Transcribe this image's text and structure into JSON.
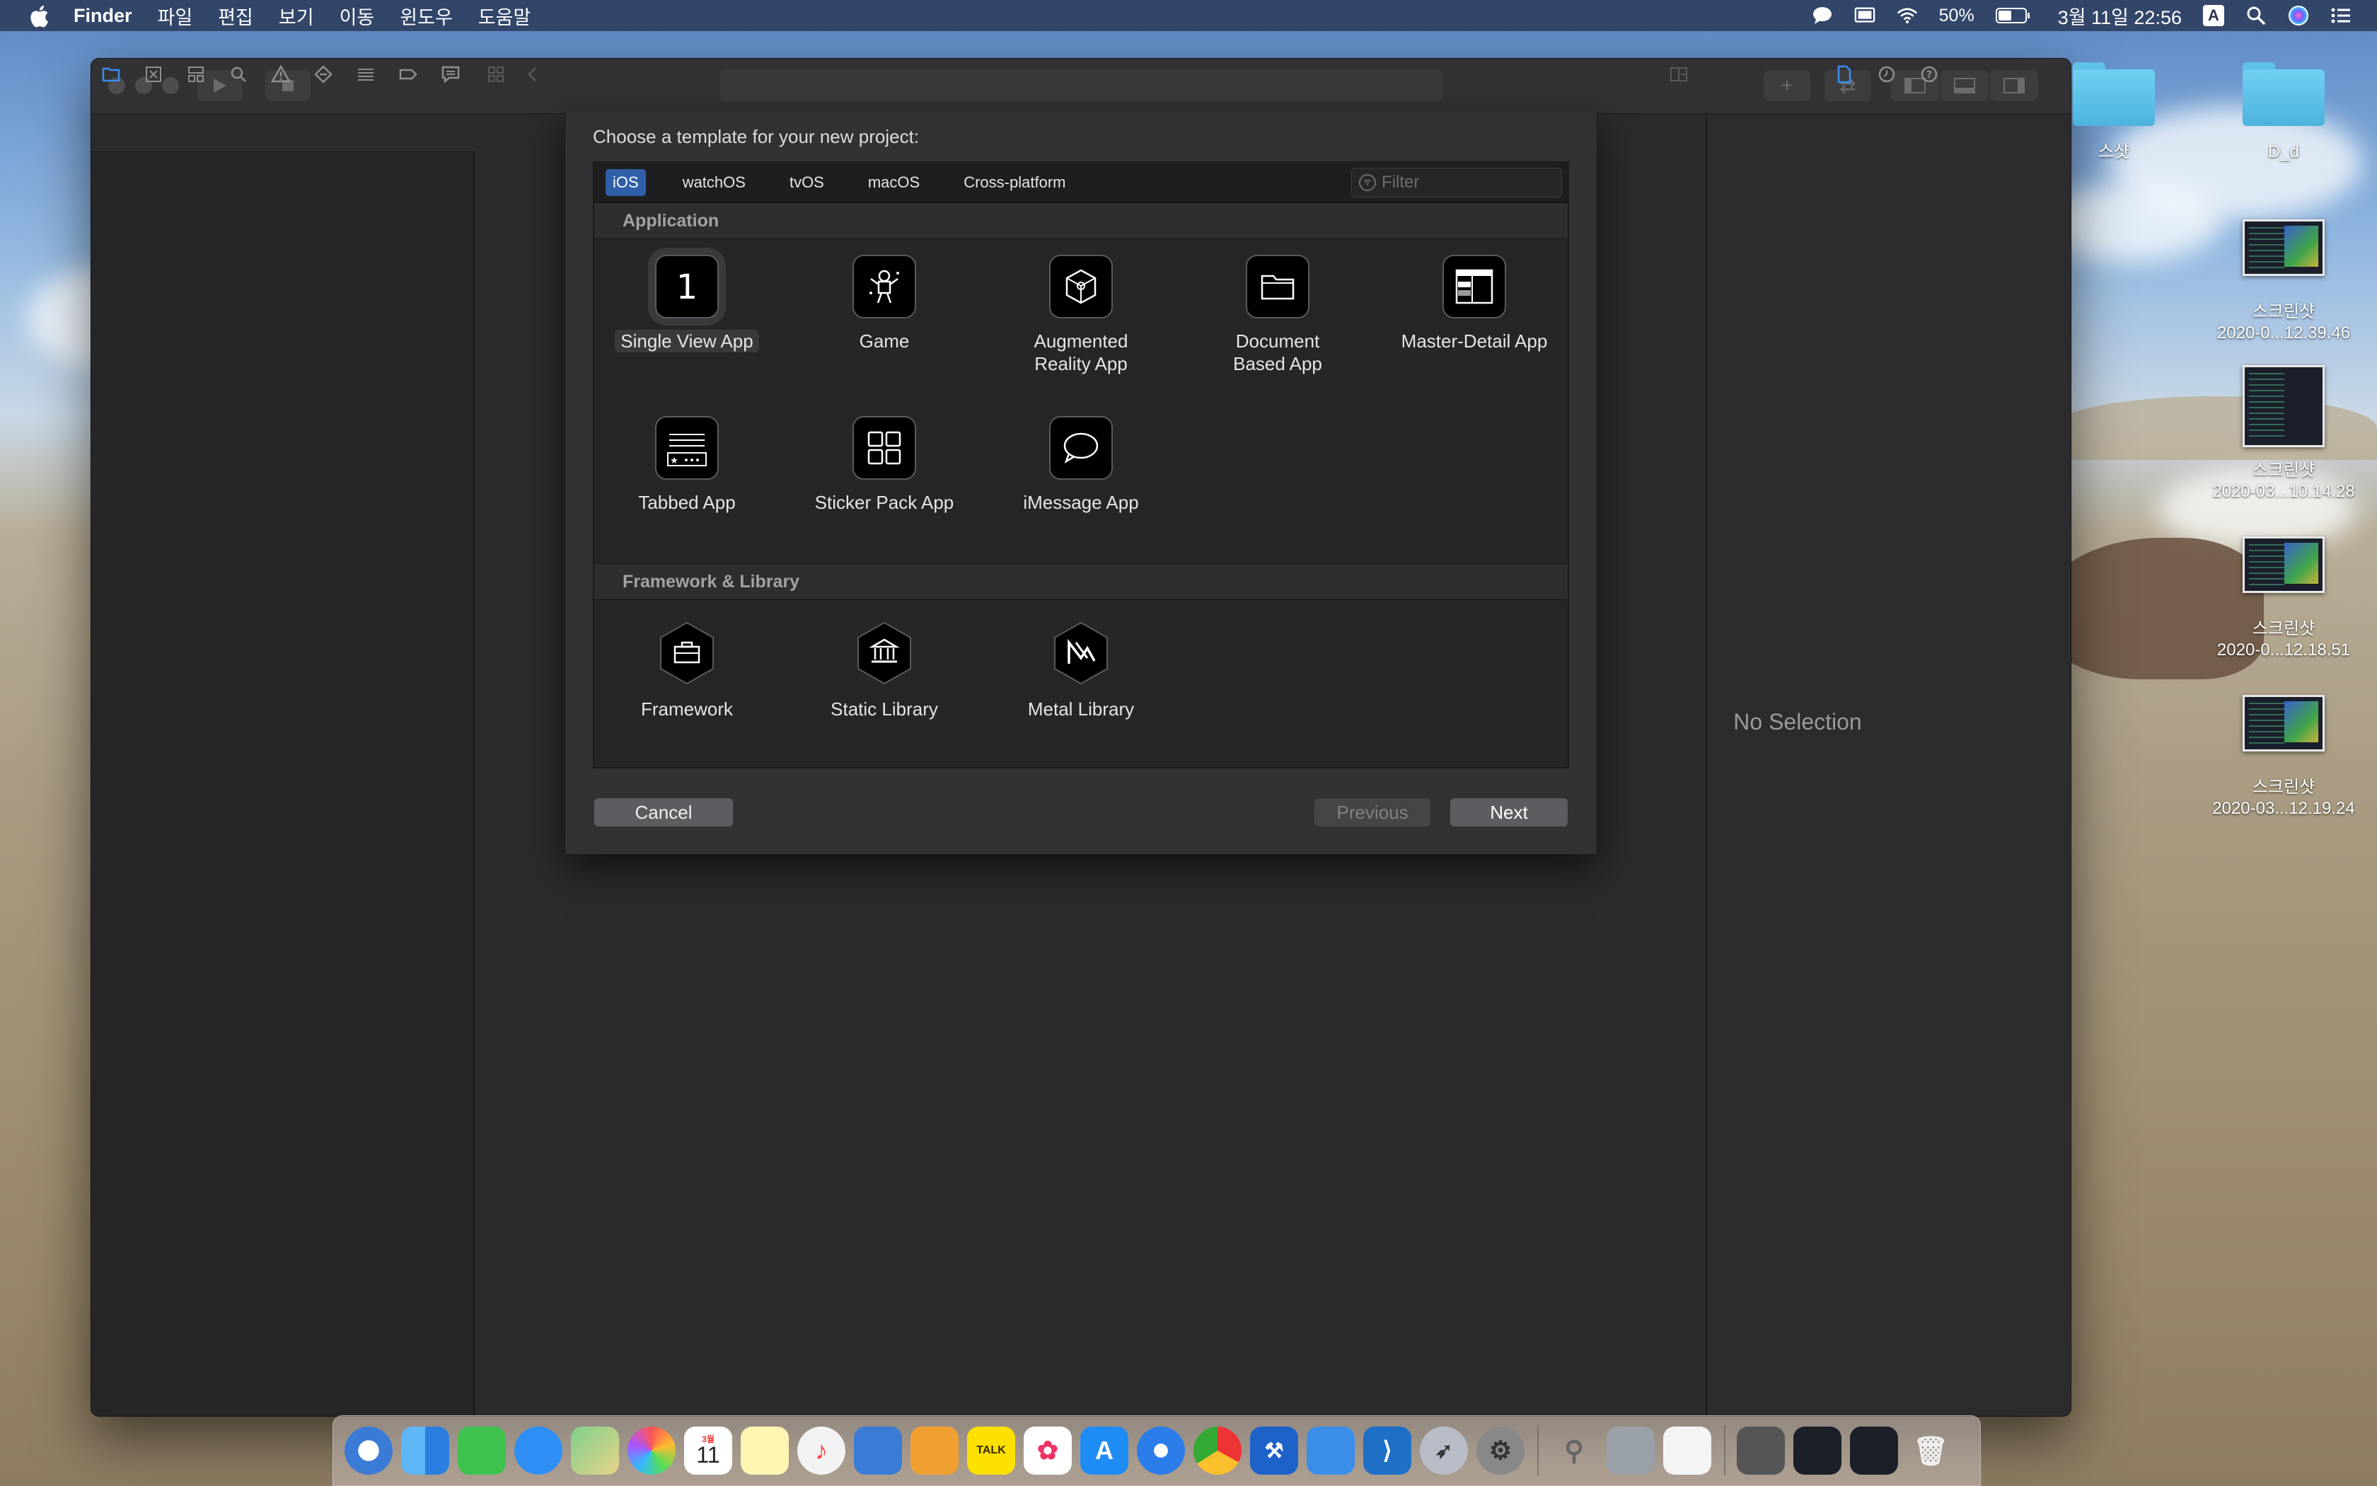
{
  "menubar": {
    "app_name": "Finder",
    "menus": [
      "파일",
      "편집",
      "보기",
      "이동",
      "윈도우",
      "도움말"
    ],
    "battery": "50%",
    "battery_level": 0.5,
    "datetime": "3월 11일  22:56",
    "input_method": "A"
  },
  "sheet": {
    "title": "Choose a template for your new project:",
    "tabs": [
      "iOS",
      "watchOS",
      "tvOS",
      "macOS",
      "Cross-platform"
    ],
    "active_tab": "iOS",
    "filter_placeholder": "Filter",
    "sections": {
      "application": {
        "header": "Application",
        "templates": [
          {
            "label_line1": "Single View App",
            "label_line2": "",
            "icon": "single-view-icon",
            "selected": true
          },
          {
            "label_line1": "Game",
            "label_line2": "",
            "icon": "game-icon"
          },
          {
            "label_line1": "Augmented",
            "label_line2": "Reality App",
            "icon": "ar-cube-icon"
          },
          {
            "label_line1": "Document",
            "label_line2": "Based App",
            "icon": "folder-icon"
          },
          {
            "label_line1": "Master-Detail App",
            "label_line2": "",
            "icon": "master-detail-icon"
          },
          {
            "label_line1": "Tabbed App",
            "label_line2": "",
            "icon": "tabbed-icon"
          },
          {
            "label_line1": "Sticker Pack App",
            "label_line2": "",
            "icon": "sticker-grid-icon"
          },
          {
            "label_line1": "iMessage App",
            "label_line2": "",
            "icon": "speech-bubble-icon"
          }
        ]
      },
      "framework": {
        "header": "Framework & Library",
        "templates": [
          {
            "label": "Framework",
            "icon": "toolbox-icon"
          },
          {
            "label": "Static Library",
            "icon": "library-building-icon"
          },
          {
            "label": "Metal Library",
            "icon": "metal-icon"
          }
        ]
      }
    },
    "buttons": {
      "cancel": "Cancel",
      "previous": "Previous",
      "next": "Next"
    }
  },
  "inspector": {
    "empty_text": "No Selection"
  },
  "desktop": {
    "items": [
      {
        "label": "스샷",
        "kind": "folder"
      },
      {
        "label": "D_d",
        "kind": "folder"
      },
      {
        "label_line1": "스크린샷",
        "label_line2": "2020-0...12.39.46",
        "kind": "screenshot"
      },
      {
        "label_line1": "스크린샷",
        "label_line2": "2020-03...10.14.28",
        "kind": "screenshot"
      },
      {
        "label_line1": "스크린샷",
        "label_line2": "2020-0...12.18.51",
        "kind": "screenshot"
      },
      {
        "label_line1": "스크린샷",
        "label_line2": "2020-03...12.19.24",
        "kind": "screenshot"
      }
    ]
  },
  "dock": {
    "calendar_month": "3월",
    "calendar_day": "11",
    "kakao_label": "TALK"
  },
  "colors": {
    "accent": "#2f5fa8",
    "window_bg": "#2b2b2d",
    "folder_blue": "#5ec1e6"
  }
}
